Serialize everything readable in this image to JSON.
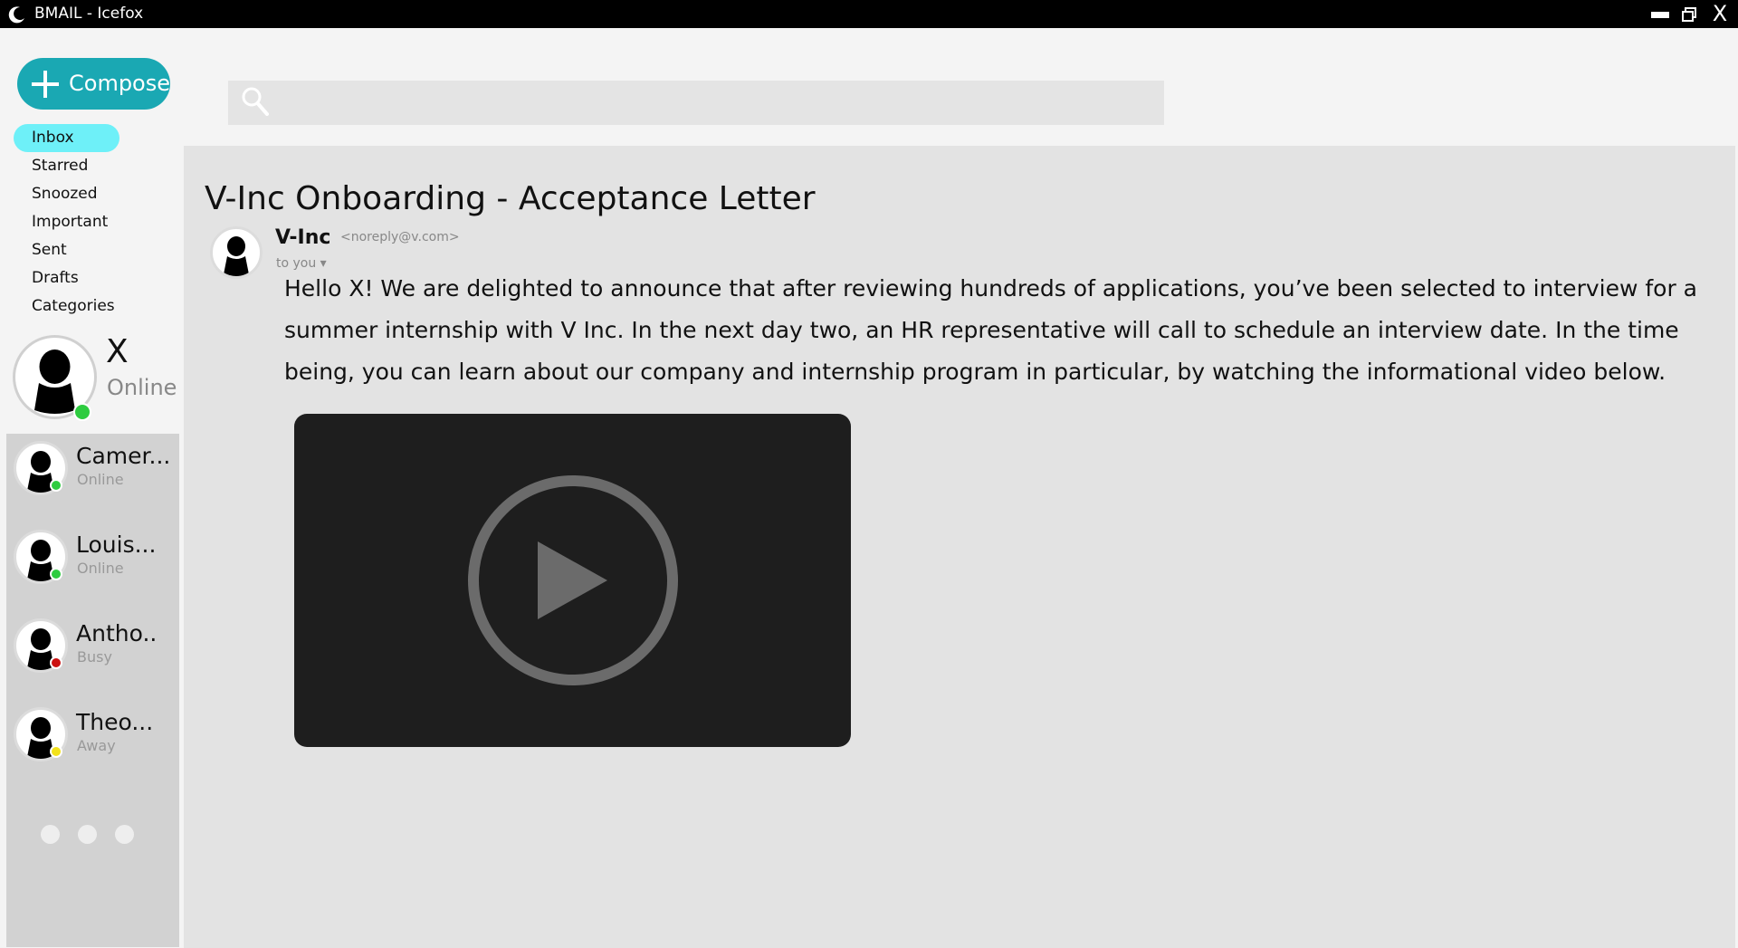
{
  "window": {
    "title": "BMAIL - Icefox",
    "close_label": "X"
  },
  "sidebar": {
    "compose_label": "Compose",
    "nav": [
      {
        "label": "Inbox",
        "active": true
      },
      {
        "label": "Starred"
      },
      {
        "label": "Snoozed"
      },
      {
        "label": "Important"
      },
      {
        "label": "Sent"
      },
      {
        "label": "Drafts"
      },
      {
        "label": "Categories"
      }
    ],
    "me": {
      "name": "X",
      "status": "Online",
      "status_color": "#2ecc40"
    },
    "contacts": [
      {
        "name": "Camer...",
        "status": "Online",
        "status_color": "#2ecc40"
      },
      {
        "name": "Louis...",
        "status": "Online",
        "status_color": "#2ecc40"
      },
      {
        "name": "Antho..",
        "status": "Busy",
        "status_color": "#cc1111"
      },
      {
        "name": "Theo...",
        "status": "Away",
        "status_color": "#f3e21a"
      }
    ]
  },
  "search": {
    "placeholder": ""
  },
  "email": {
    "subject": "V-Inc Onboarding - Acceptance Letter",
    "sender_name": "V-Inc",
    "sender_email": "<noreply@v.com>",
    "to_line": "to you ▾",
    "body": "Hello X! We are delighted to announce that after reviewing hundreds of applications, you’ve been selected to interview for a summer internship with V Inc. In the next day two, an HR representative will call to schedule an interview date. In the time being, you can learn about our company and internship program in particular, by watching the informational video below."
  },
  "colors": {
    "accent": "#1aa8b3",
    "active_nav": "#6ef0f8"
  }
}
